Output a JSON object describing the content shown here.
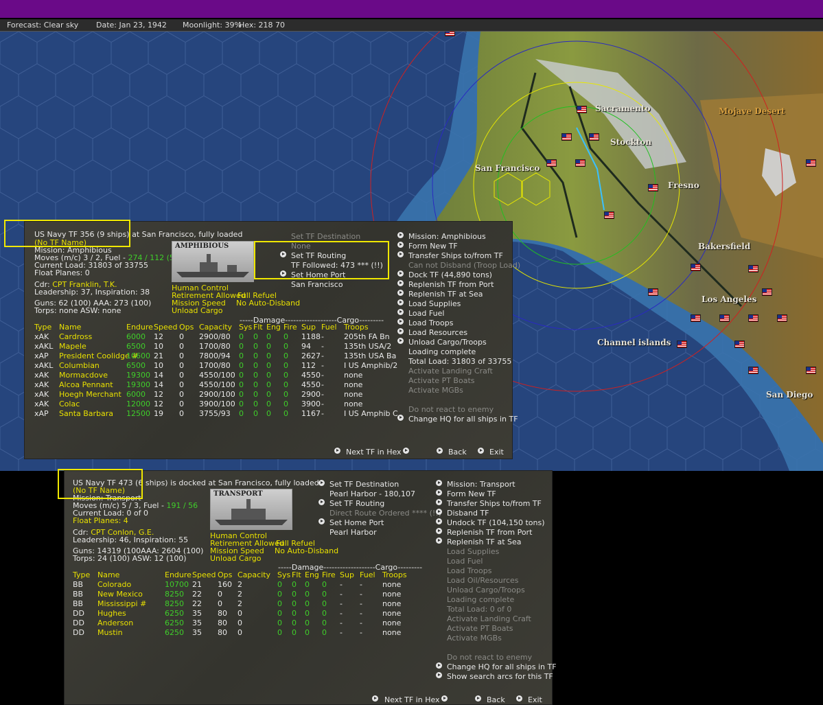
{
  "status": {
    "forecast": "Forecast: Clear sky",
    "date": "Date:  Jan 23, 1942",
    "moonlight": "Moonlight: 39%",
    "hex": "Hex: 218  70"
  },
  "map": {
    "labels": [
      "Sacramento",
      "Mojave Desert",
      "Stockton",
      "San Francisco",
      "Fresno",
      "Bakersfield",
      "Los Angeles",
      "Channel islands",
      "San Diego"
    ]
  },
  "tf1": {
    "header": "US Navy TF 356 (9 ships) at San Francisco, fully loaded",
    "name": "(No TF Name)",
    "mission": "Mission:  Amphibious",
    "moves_label": "Moves (m/c)  3 / 2, Fuel - ",
    "moves_fuel": "274 / 112 (5(",
    "load": "Current Load:  31803 of 33755",
    "float": "Float Planes:  0",
    "image_label": "AMPHIBIOUS",
    "cdr_label": "Cdr: ",
    "cdr_name": "CPT  Franklin, T.K.",
    "leadership": "Leadership: 37, Inspiration: 38",
    "guns": "Guns: 62 (100)   AAA: 273 (100)",
    "torps": "Torps: none        ASW: none",
    "opts": [
      "Human Control",
      "Retirement Allowed",
      "Full Refuel",
      "Mission Speed",
      "No Auto-Disband",
      "Unload Cargo"
    ],
    "middle": {
      "dest": "Set TF Destination",
      "none": "None",
      "routing": "Set TF Routing",
      "followed": "TF Followed: 473  *** (!!)",
      "homeport": "Set Home Port",
      "homeport_val": "San Francisco"
    },
    "menu": [
      {
        "label": "Mission: Amphibious",
        "active": true,
        "arrow": true
      },
      {
        "label": "Form New TF",
        "active": true,
        "arrow": true
      },
      {
        "label": "Transfer Ships to/from TF",
        "active": true,
        "arrow": true
      },
      {
        "label": "Can not Disband (Troop Load)",
        "active": false,
        "arrow": false
      },
      {
        "label": "Dock TF (44,890 tons)",
        "active": true,
        "arrow": true
      },
      {
        "label": "Replenish TF from Port",
        "active": true,
        "arrow": true
      },
      {
        "label": "Replenish TF at Sea",
        "active": true,
        "arrow": true
      },
      {
        "label": "Load Supplies",
        "active": true,
        "arrow": true
      },
      {
        "label": "Load Fuel",
        "active": true,
        "arrow": true
      },
      {
        "label": "Load Troops",
        "active": true,
        "arrow": true
      },
      {
        "label": "Load Resources",
        "active": true,
        "arrow": true
      },
      {
        "label": "Unload Cargo/Troops",
        "active": true,
        "arrow": true
      },
      {
        "label": "Loading complete",
        "active": true,
        "arrow": false
      },
      {
        "label": "Total Load: 31803 of 33755",
        "active": true,
        "arrow": false
      },
      {
        "label": "Activate Landing Craft",
        "active": false,
        "arrow": false
      },
      {
        "label": "Activate PT Boats",
        "active": false,
        "arrow": false
      },
      {
        "label": "Activate MGBs",
        "active": false,
        "arrow": false
      },
      {
        "label": "",
        "active": false,
        "arrow": false
      },
      {
        "label": "Do not react to enemy",
        "active": false,
        "arrow": false
      },
      {
        "label": "Change HQ for all ships in TF",
        "active": true,
        "arrow": true
      }
    ],
    "damage_header": "-----Damage-------------------Cargo---------",
    "cols": [
      "Type",
      "Name",
      "Endure",
      "Speed",
      "Ops",
      "Capacity",
      "Sys",
      "Flt",
      "Eng",
      "Fire",
      "Sup",
      "Fuel",
      "Troops"
    ],
    "ships": [
      [
        "xAK",
        "Cardross",
        "6000",
        "12",
        "0",
        "2900/80",
        "0",
        "0",
        "0",
        "0",
        "1188",
        "-",
        "205th FA Bn"
      ],
      [
        "xAKL",
        "Mapele",
        "6500",
        "10",
        "0",
        "1700/80",
        "0",
        "0",
        "0",
        "0",
        "94",
        "-",
        "135th USA/2"
      ],
      [
        "xAP",
        "President Coolidge #",
        "10600",
        "21",
        "0",
        "7800/94",
        "0",
        "0",
        "0",
        "0",
        "2627",
        "-",
        "135th USA Ba"
      ],
      [
        "xAKL",
        "Columbian",
        "6500",
        "10",
        "0",
        "1700/80",
        "0",
        "0",
        "0",
        "0",
        "112",
        "-",
        "I US Amphib/2"
      ],
      [
        "xAK",
        "Mormacdove",
        "19300",
        "14",
        "0",
        "4550/100",
        "0",
        "0",
        "0",
        "0",
        "4550",
        "-",
        "none"
      ],
      [
        "xAK",
        "Alcoa Pennant",
        "19300",
        "14",
        "0",
        "4550/100",
        "0",
        "0",
        "0",
        "0",
        "4550",
        "-",
        "none"
      ],
      [
        "xAK",
        "Hoegh Merchant",
        "6000",
        "12",
        "0",
        "2900/100",
        "0",
        "0",
        "0",
        "0",
        "2900",
        "-",
        "none"
      ],
      [
        "xAK",
        "Colac",
        "12000",
        "12",
        "0",
        "3900/100",
        "0",
        "0",
        "0",
        "0",
        "3900",
        "-",
        "none"
      ],
      [
        "xAP",
        "Santa Barbara",
        "12500",
        "19",
        "0",
        "3755/93",
        "0",
        "0",
        "0",
        "0",
        "1167",
        "-",
        "I US Amphib C"
      ]
    ],
    "nav": {
      "next": "Next TF in Hex",
      "back": "Back",
      "exit": "Exit"
    }
  },
  "tf2": {
    "header": "US Navy TF 473 (6 ships) is docked at San Francisco, fully loaded",
    "name": "(No TF Name)",
    "mission": "Mission:  Transport",
    "moves_label": "Moves (m/c)  5 / 3, Fuel - ",
    "moves_fuel": "191 / 56",
    "load": "Current Load:  0 of 0",
    "float": "Float Planes:  4",
    "image_label": "TRANSPORT",
    "cdr_label": "Cdr: ",
    "cdr_name": "CPT  Conlon, G.E.",
    "leadership": "Leadership: 46, Inspiration: 55",
    "guns": "Guns: 14319 (100AAA: 2604 (100)",
    "torps": "Torps: 24 (100)  ASW: 12 (100)",
    "opts": [
      "Human Control",
      "Retirement Allowed",
      "Full Refuel",
      "Mission Speed",
      "No Auto-Disband",
      "Unload Cargo"
    ],
    "middle": {
      "dest": "Set TF Destination",
      "dest_val": "Pearl Harbor - 180,107",
      "routing": "Set TF Routing",
      "direct": "Direct Route Ordered  **** (!!)",
      "homeport": "Set Home Port",
      "homeport_val": "Pearl Harbor"
    },
    "menu": [
      {
        "label": "Mission: Transport",
        "active": true,
        "arrow": true
      },
      {
        "label": "Form New TF",
        "active": true,
        "arrow": true
      },
      {
        "label": "Transfer Ships to/from TF",
        "active": true,
        "arrow": true
      },
      {
        "label": "Disband TF",
        "active": true,
        "arrow": true
      },
      {
        "label": "Undock TF (104,150 tons)",
        "active": true,
        "arrow": true
      },
      {
        "label": "Replenish TF from Port",
        "active": true,
        "arrow": true
      },
      {
        "label": "Replenish TF at Sea",
        "active": true,
        "arrow": true
      },
      {
        "label": "Load Supplies",
        "active": false,
        "arrow": false
      },
      {
        "label": "Load Fuel",
        "active": false,
        "arrow": false
      },
      {
        "label": "Load Troops",
        "active": false,
        "arrow": false
      },
      {
        "label": "Load Oil/Resources",
        "active": false,
        "arrow": false
      },
      {
        "label": "Unload Cargo/Troops",
        "active": false,
        "arrow": false
      },
      {
        "label": "Loading complete",
        "active": false,
        "arrow": false
      },
      {
        "label": "Total Load: 0 of 0",
        "active": false,
        "arrow": false
      },
      {
        "label": "Activate Landing Craft",
        "active": false,
        "arrow": false
      },
      {
        "label": "Activate PT Boats",
        "active": false,
        "arrow": false
      },
      {
        "label": "Activate MGBs",
        "active": false,
        "arrow": false
      },
      {
        "label": "",
        "active": false,
        "arrow": false
      },
      {
        "label": "Do not react to enemy",
        "active": false,
        "arrow": false
      },
      {
        "label": "Change HQ for all ships in TF",
        "active": true,
        "arrow": true
      },
      {
        "label": "Show search arcs for this TF",
        "active": true,
        "arrow": true
      }
    ],
    "damage_header": "-----Damage-------------------Cargo---------",
    "cols": [
      "Type",
      "Name",
      "Endure",
      "Speed",
      "Ops",
      "Capacity",
      "Sys",
      "Flt",
      "Eng",
      "Fire",
      "Sup",
      "Fuel",
      "Troops"
    ],
    "ships": [
      [
        "BB",
        "Colorado",
        "10700",
        "21",
        "160",
        "2",
        "0",
        "0",
        "0",
        "0",
        "-",
        "-",
        "none"
      ],
      [
        "BB",
        "New Mexico",
        "8250",
        "22",
        "0",
        "2",
        "0",
        "0",
        "0",
        "0",
        "-",
        "-",
        "none"
      ],
      [
        "BB",
        "Mississippi #",
        "8250",
        "22",
        "0",
        "2",
        "0",
        "0",
        "0",
        "0",
        "-",
        "-",
        "none"
      ],
      [
        "DD",
        "Hughes",
        "6250",
        "35",
        "80",
        "0",
        "0",
        "0",
        "0",
        "0",
        "-",
        "-",
        "none"
      ],
      [
        "DD",
        "Anderson",
        "6250",
        "35",
        "80",
        "0",
        "0",
        "0",
        "0",
        "0",
        "-",
        "-",
        "none"
      ],
      [
        "DD",
        "Mustin",
        "6250",
        "35",
        "80",
        "0",
        "0",
        "0",
        "0",
        "0",
        "-",
        "-",
        "none"
      ]
    ],
    "nav": {
      "next": "Next TF in Hex",
      "back": "Back",
      "exit": "Exit"
    }
  }
}
